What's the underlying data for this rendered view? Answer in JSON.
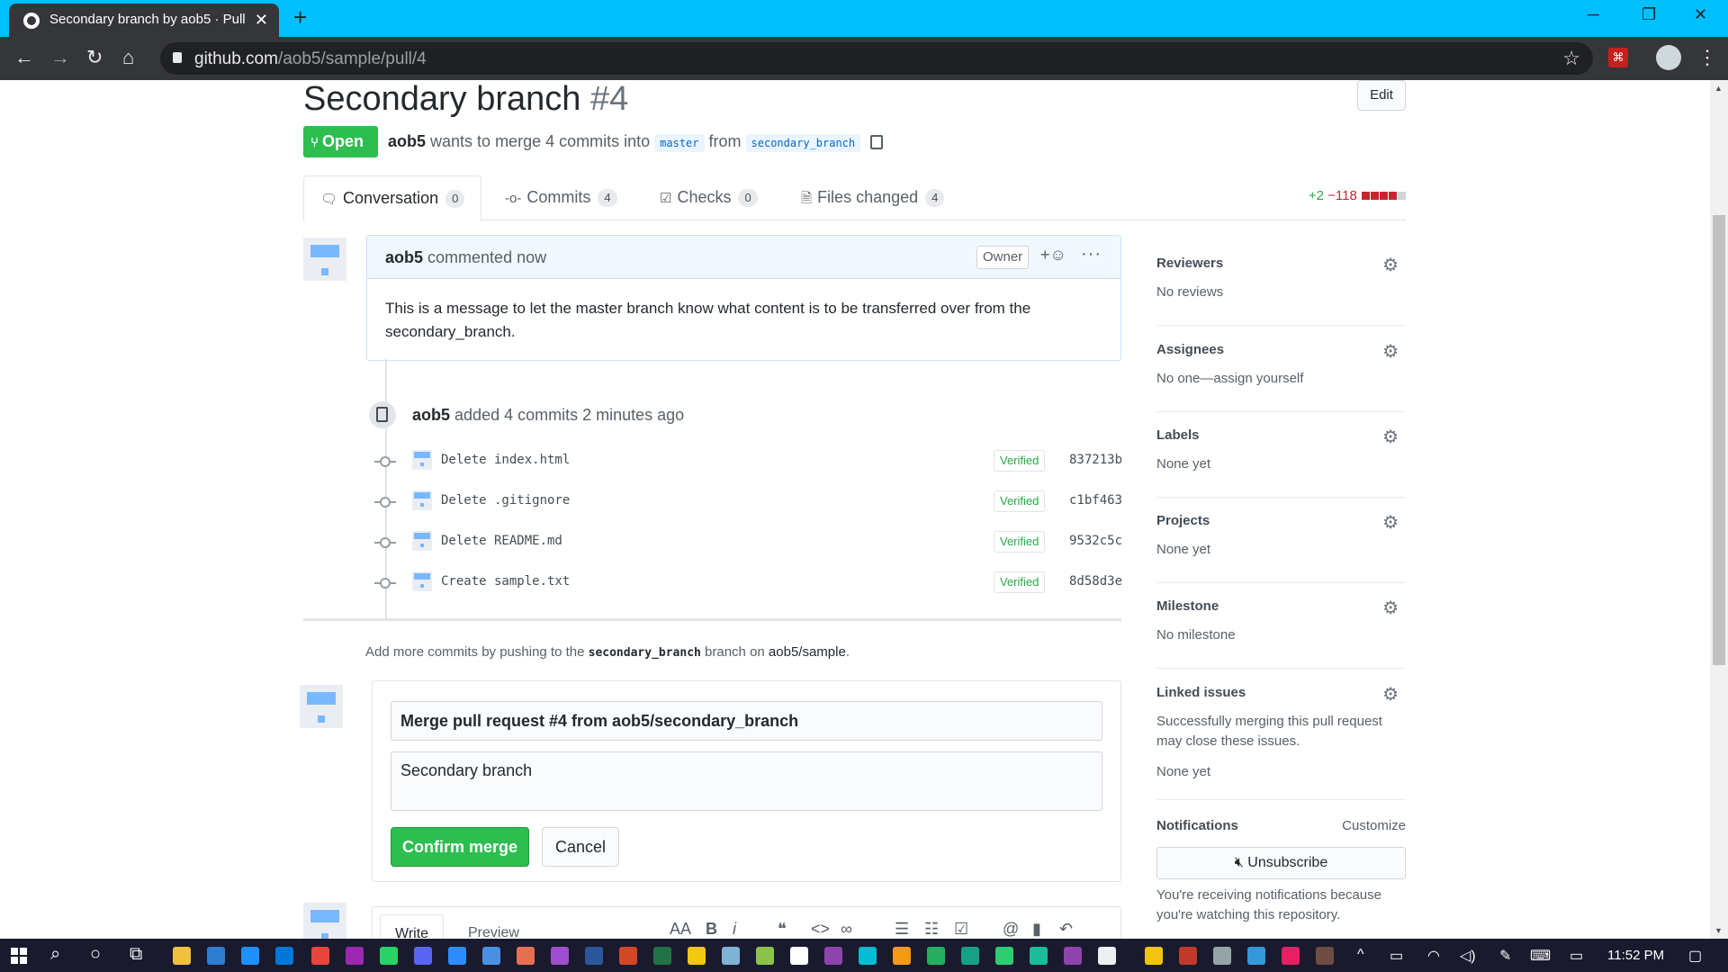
{
  "browser": {
    "tab_title": "Secondary branch by aob5 · Pull",
    "url_host": "github.com",
    "url_path": "/aob5/sample/pull/4",
    "close_glyph": "✕",
    "new_tab_glyph": "+",
    "minimize_glyph": "─",
    "restore_glyph": "❐",
    "window_close_glyph": "✕",
    "back_glyph": "←",
    "forward_glyph": "→",
    "reload_glyph": "↻",
    "home_glyph": "⌂",
    "star_glyph": "☆",
    "menu_glyph": "⋮"
  },
  "pr": {
    "title": "Secondary branch",
    "number": "#4",
    "edit_label": "Edit",
    "state": "Open",
    "author": "aob5",
    "merge_text_1": "wants to merge 4 commits into",
    "base_branch": "master",
    "merge_text_2": "from",
    "head_branch": "secondary_branch"
  },
  "tabs": [
    {
      "label": "Conversation",
      "count": "0",
      "icon": "comment-discussion-icon"
    },
    {
      "label": "Commits",
      "count": "4",
      "icon": "git-commit-icon"
    },
    {
      "label": "Checks",
      "count": "0",
      "icon": "checklist-icon"
    },
    {
      "label": "Files changed",
      "count": "4",
      "icon": "file-diff-icon"
    }
  ],
  "diffstat": {
    "additions": "+2",
    "deletions": "−118"
  },
  "comment": {
    "author": "aob5",
    "time": "commented now",
    "badge": "Owner",
    "body": "This is a message to let the master branch know what content is to be transferred over from the secondary_branch."
  },
  "commits_event": {
    "author": "aob5",
    "text": "added 4 commits 2 minutes ago"
  },
  "commits": [
    {
      "message": "Delete index.html",
      "verified": "Verified",
      "sha": "837213b"
    },
    {
      "message": "Delete .gitignore",
      "verified": "Verified",
      "sha": "c1bf463"
    },
    {
      "message": "Delete README.md",
      "verified": "Verified",
      "sha": "9532c5c"
    },
    {
      "message": "Create sample.txt",
      "verified": "Verified",
      "sha": "8d58d3e"
    }
  ],
  "push_hint": {
    "prefix": "Add more commits by pushing to the",
    "branch": "secondary_branch",
    "middle": "branch on",
    "repo": "aob5/sample",
    "suffix": "."
  },
  "merge": {
    "title_value": "Merge pull request #4 from aob5/secondary_branch",
    "body_value": "Secondary branch",
    "confirm_label": "Confirm merge",
    "cancel_label": "Cancel"
  },
  "editor": {
    "write_tab": "Write",
    "preview_tab": "Preview"
  },
  "sidebar": {
    "reviewers": {
      "heading": "Reviewers",
      "value": "No reviews"
    },
    "assignees": {
      "heading": "Assignees",
      "value": "No one—assign yourself"
    },
    "labels": {
      "heading": "Labels",
      "value": "None yet"
    },
    "projects": {
      "heading": "Projects",
      "value": "None yet"
    },
    "milestone": {
      "heading": "Milestone",
      "value": "No milestone"
    },
    "linked_issues": {
      "heading": "Linked issues",
      "description": "Successfully merging this pull request may close these issues.",
      "value": "None yet"
    },
    "notifications": {
      "heading": "Notifications",
      "customize": "Customize",
      "unsubscribe": "Unsubscribe",
      "reason": "You're receiving notifications because you're watching this repository."
    }
  },
  "taskbar": {
    "time": "11:52 PM"
  },
  "colors": {
    "tab_strip": "#00bfff",
    "open_green": "#2cbe4e",
    "link_blue": "#0366d6",
    "diff_add": "#28a745",
    "diff_del": "#cb2431"
  }
}
